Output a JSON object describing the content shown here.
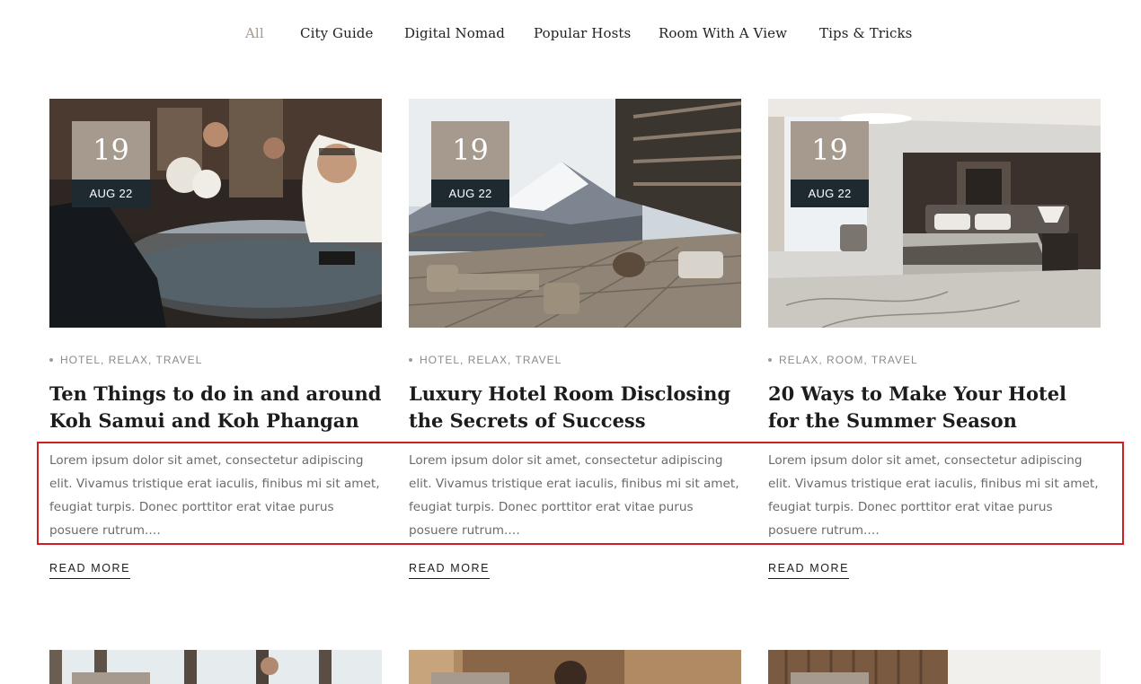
{
  "filters": [
    {
      "label": "All",
      "active": true
    },
    {
      "label": "City Guide",
      "active": false
    },
    {
      "label": "Digital Nomad",
      "active": false
    },
    {
      "label": "Popular Hosts",
      "active": false
    },
    {
      "label": "Room With A View",
      "active": false
    },
    {
      "label": "Tips & Tricks",
      "active": false
    }
  ],
  "posts": [
    {
      "day": "19",
      "month": "AUG 22",
      "categories": [
        "HOTEL",
        "RELAX",
        "TRAVEL"
      ],
      "title": "Ten Things to do in and around Koh Samui and Koh Phangan",
      "excerpt": "Lorem ipsum dolor sit amet, consectetur adipiscing elit. Vivamus tristique erat iaculis, finibus mi sit amet, feugiat turpis. Donec porttitor erat vitae purus posuere rutrum.…",
      "read_more": "READ MORE"
    },
    {
      "day": "19",
      "month": "AUG 22",
      "categories": [
        "HOTEL",
        "RELAX",
        "TRAVEL"
      ],
      "title": "Luxury Hotel Room Disclosing the Secrets of Success",
      "excerpt": "Lorem ipsum dolor sit amet, consectetur adipiscing elit. Vivamus tristique erat iaculis, finibus mi sit amet, feugiat turpis. Donec porttitor erat vitae purus posuere rutrum.…",
      "read_more": "READ MORE"
    },
    {
      "day": "19",
      "month": "AUG 22",
      "categories": [
        "RELAX",
        "ROOM",
        "TRAVEL"
      ],
      "title": "20 Ways to Make Your Hotel for the Summer Season",
      "excerpt": "Lorem ipsum dolor sit amet, consectetur adipiscing elit. Vivamus tristique erat iaculis, finibus mi sit amet, feugiat turpis. Donec porttitor erat vitae purus posuere rutrum.…",
      "read_more": "READ MORE"
    }
  ],
  "colors": {
    "accent": "#a69a8e",
    "dark": "#1e2a30",
    "highlight": "#d01f24"
  }
}
